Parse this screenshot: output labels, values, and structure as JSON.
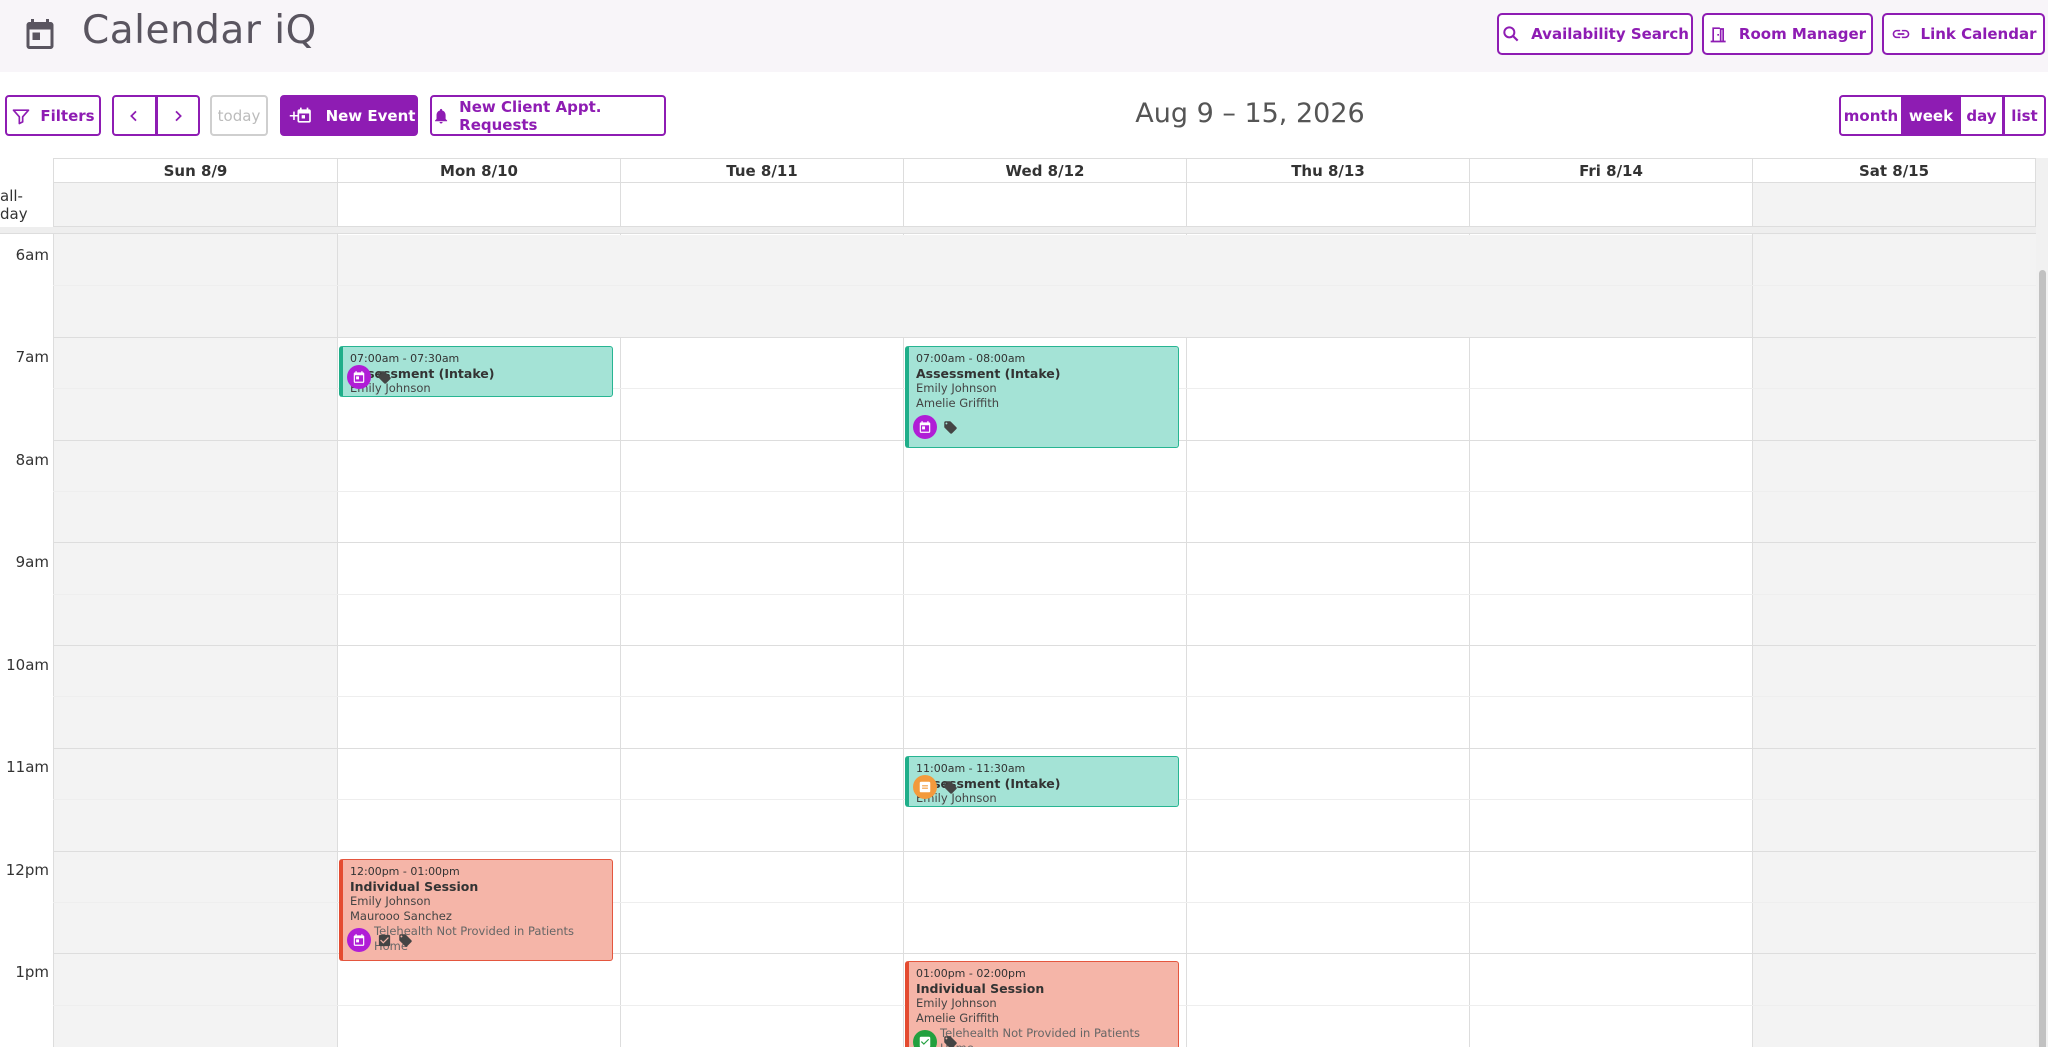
{
  "header": {
    "title": "Calendar iQ",
    "availability_search": "Availability Search",
    "room_manager": "Room Manager",
    "link_calendar": "Link Calendar"
  },
  "toolbar": {
    "filters": "Filters",
    "today": "today",
    "new_event": "New Event",
    "new_requests": "New Client Appt. Requests",
    "range_title": "Aug 9 – 15, 2026",
    "views": [
      "month",
      "week",
      "day",
      "list"
    ],
    "active_view": "week"
  },
  "days": [
    "Sun 8/9",
    "Mon 8/10",
    "Tue 8/11",
    "Wed 8/12",
    "Thu 8/13",
    "Fri 8/14",
    "Sat 8/15"
  ],
  "allday_label": "all-day",
  "hours": [
    "6am",
    "7am",
    "8am",
    "9am",
    "10am",
    "11am",
    "12pm",
    "1pm"
  ],
  "events": [
    {
      "time": "07:00am - 07:30am",
      "title": "Assessment (Intake)",
      "people": [
        "Emily Johnson"
      ],
      "color": "#a4e3d6"
    },
    {
      "time": "07:00am - 08:00am",
      "title": "Assessment (Intake)",
      "people": [
        "Emily Johnson",
        "Amelie Griffith"
      ],
      "color": "#a4e3d6"
    },
    {
      "time": "11:00am - 11:30am",
      "title": "Assessment (Intake)",
      "people": [
        "Emily Johnson"
      ],
      "color": "#a4e3d6"
    },
    {
      "time": "12:00pm - 01:00pm",
      "title": "Individual Session",
      "people": [
        "Emily Johnson",
        "Maurooo Sanchez"
      ],
      "note": "Telehealth Not Provided in Patients Home",
      "color": "#f5b5a8"
    },
    {
      "time": "01:00pm - 02:00pm",
      "title": "Individual Session",
      "people": [
        "Emily Johnson",
        "Amelie Griffith"
      ],
      "note": "Telehealth Not Provided in Patients Home",
      "color": "#f5b5a8"
    }
  ],
  "colors": {
    "brand": "#8e1cb3",
    "intake": "#a4e3d6",
    "session": "#f5b5a8"
  }
}
